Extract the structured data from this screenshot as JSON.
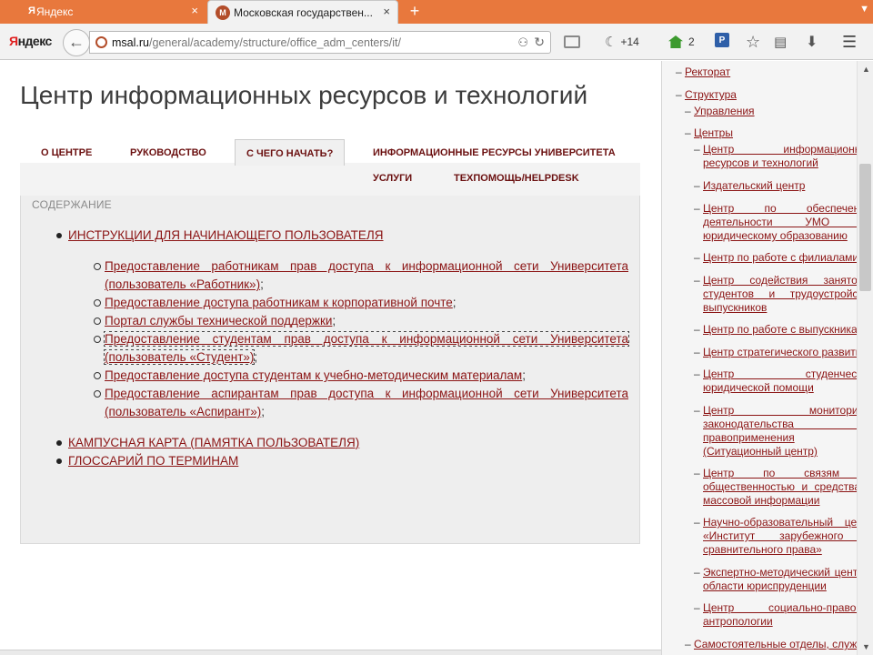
{
  "browser": {
    "tabs": [
      {
        "favicon": "Я",
        "title": "Яндекс",
        "close": "×"
      },
      {
        "favicon": "М",
        "title": "Московская государствен...",
        "close": "×"
      }
    ],
    "new_tab": "+",
    "tab_scroll": "▼",
    "logo_first": "Я",
    "logo_rest": "ндекс",
    "back": "←",
    "url_host": "msal.ru",
    "url_path": "/general/academy/structure/office_adm_centers/it/",
    "reader_icon": "⚇",
    "reload_icon": "↻",
    "weather_icon": "☾",
    "weather_text": "+14",
    "sync_count": "2",
    "pocket_label": "P",
    "star_icon": "☆",
    "clip_icon": "▤",
    "download_icon": "⬇",
    "menu_icon": "☰"
  },
  "page": {
    "title": "Центр информационных ресурсов и технологий",
    "tabs": [
      {
        "label": "О центре"
      },
      {
        "label": "Руководство"
      },
      {
        "label": "С чего начать?"
      },
      {
        "label": "Информационные ресурсы университета"
      },
      {
        "label": "Услуги"
      },
      {
        "label": "Техпомощь/HelpDesk"
      }
    ],
    "panel_heading": "Содержание",
    "sections": [
      {
        "label": "ИНСТРУКЦИИ ДЛЯ НАЧИНАЮЩЕГО ПОЛЬЗОВАТЕЛЯ"
      },
      {
        "label": "КАМПУСНАЯ КАРТА (ПАМЯТКА ПОЛЬЗОВАТЕЛЯ)"
      },
      {
        "label": "ГЛОССАРИЙ ПО ТЕРМИНАМ"
      }
    ],
    "subitems": [
      {
        "link": "Предоставление работникам прав доступа к информационной сети Университета (пользователь «Работник»)",
        "suffix": ";"
      },
      {
        "link": "Предоставление доступа работникам к корпоративной почте",
        "suffix": ";"
      },
      {
        "link": "Портал службы технической поддержки",
        "suffix": ";"
      },
      {
        "link": "Предоставление студентам прав доступа к информационной сети Университета (пользователь «Студент»)",
        "suffix": ";"
      },
      {
        "link": "Предоставление доступа студентам к учебно-методическим материалам",
        "suffix": ";"
      },
      {
        "link": "Предоставление аспирантам прав доступа к информационной сети Университета (пользователь «Аспирант»)",
        "suffix": ";"
      }
    ]
  },
  "sidebar": {
    "dash": "–",
    "items": [
      {
        "label": "Ректорат"
      },
      {
        "label": "Структура"
      },
      {
        "label": "Управления"
      },
      {
        "label": "Центры"
      },
      {
        "label": "Центр информационных ресурсов и технологий"
      },
      {
        "label": "Издательский центр"
      },
      {
        "label": "Центр по обеспечению деятельности УМО по юридическому образованию"
      },
      {
        "label": "Центр по работе с филиалами"
      },
      {
        "label": "Центр содействия занятости студентов и трудоустройству выпускников"
      },
      {
        "label": "Центр по работе с выпускниками"
      },
      {
        "label": "Центр стратегического развития"
      },
      {
        "label": "Центр студенческой юридической помощи"
      },
      {
        "label": "Центр мониторинга законодательства и правоприменения (Ситуационный центр)"
      },
      {
        "label": "Центр по связям с общественностью и средствами массовой информации"
      },
      {
        "label": "Научно-образовательный центр «Институт зарубежного и сравнительного права»"
      },
      {
        "label": "Экспертно-методический центр в области юриспруденции"
      },
      {
        "label": "Центр социально-правовой антропологии"
      },
      {
        "label": "Самостоятельные отделы, службы"
      }
    ]
  },
  "scrollbar": {
    "up": "▲",
    "down": "▼"
  }
}
